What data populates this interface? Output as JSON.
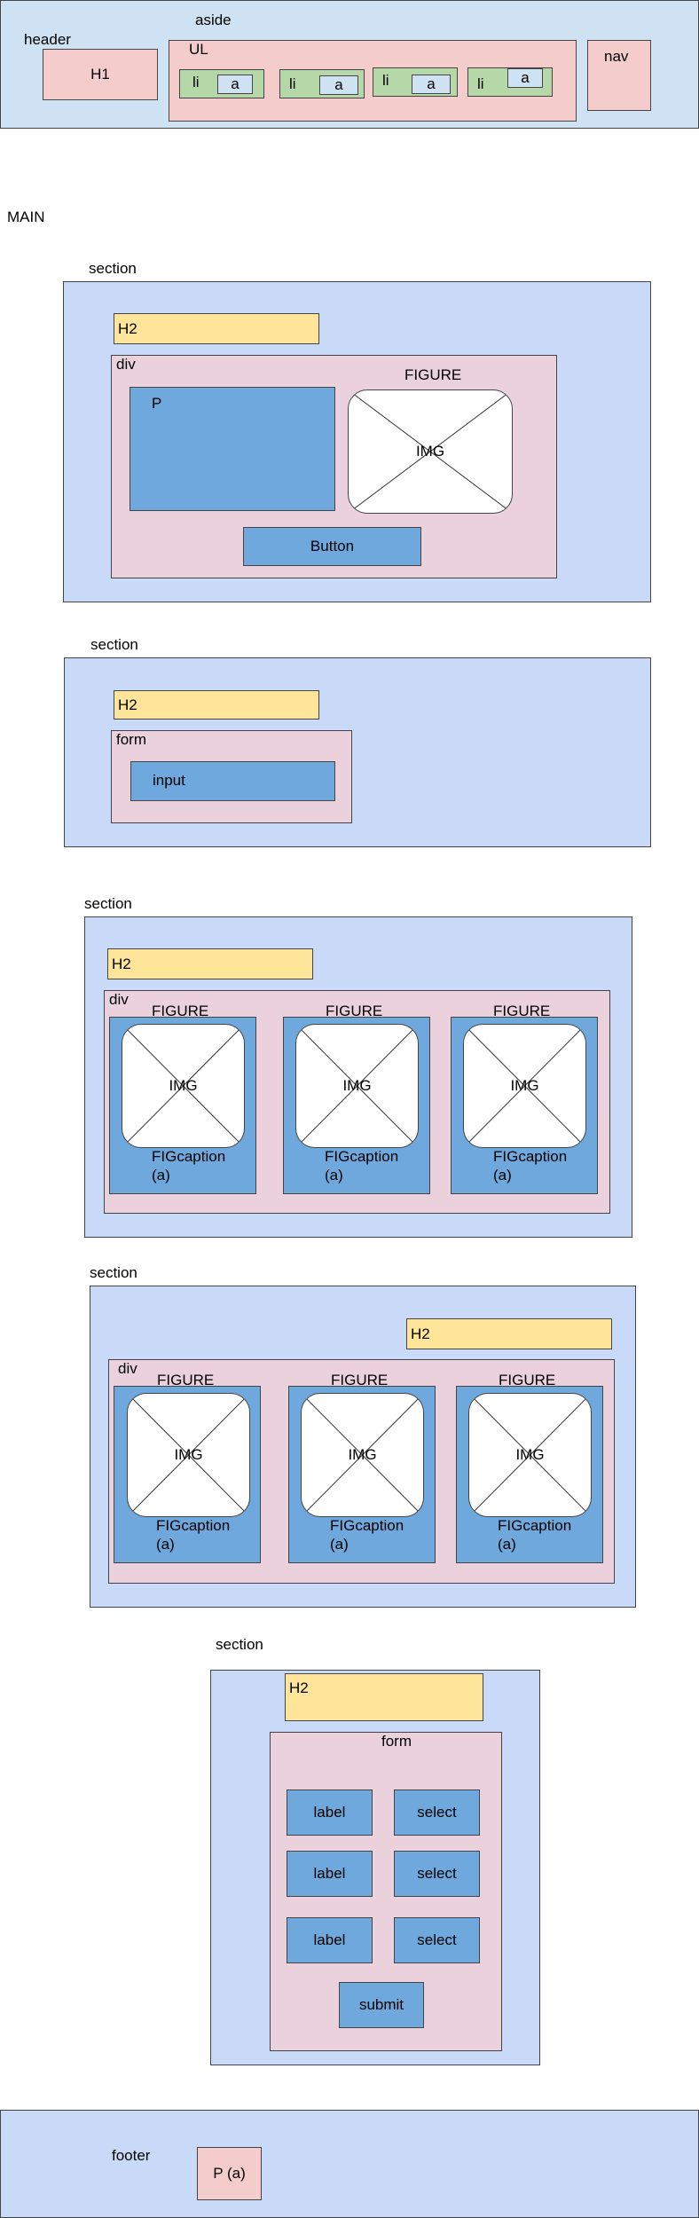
{
  "header": {
    "header_label": "header",
    "aside_label": "aside",
    "h1": "H1",
    "ul": "UL",
    "li": "li",
    "a": "a",
    "nav": "nav"
  },
  "main_label": "MAIN",
  "sections": {
    "s1": {
      "label": "section",
      "h2": "H2",
      "div": "div",
      "p": "P",
      "figure": "FIGURE",
      "img": "IMG",
      "button": "Button"
    },
    "s2": {
      "label": "section",
      "h2": "H2",
      "form": "form",
      "input": "input"
    },
    "s3": {
      "label": "section",
      "h2": "H2",
      "div": "div",
      "figure": "FIGURE",
      "img": "IMG",
      "figcaption": "FIGcaption",
      "a": "(a)"
    },
    "s4": {
      "label": "section",
      "h2": "H2",
      "div": "div",
      "figure": "FIGURE",
      "img": "IMG",
      "figcaption": "FIGcaption",
      "a": "(a)"
    },
    "s5": {
      "label": "section",
      "h2": "H2",
      "form": "form",
      "label_text": "label",
      "select_text": "select",
      "submit": "submit"
    }
  },
  "footer": {
    "label": "footer",
    "p": "P (a)"
  }
}
